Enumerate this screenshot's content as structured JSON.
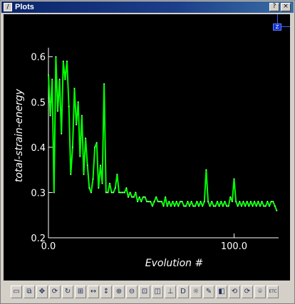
{
  "window": {
    "title": "Plots"
  },
  "titlebar_buttons": [
    {
      "name": "help-button",
      "glyph": "?"
    },
    {
      "name": "close-button",
      "glyph": "×"
    }
  ],
  "corner_icon": {
    "glyph": "Z"
  },
  "chart_data": {
    "type": "line",
    "xlabel": "Evolution  #",
    "ylabel": "total-strain-energy",
    "xlim": [
      0,
      124
    ],
    "ylim": [
      0.2,
      0.62
    ],
    "xticks": [
      0,
      100
    ],
    "xtick_labels": [
      "0.0",
      "100.0"
    ],
    "yticks": [
      0.2,
      0.3,
      0.4,
      0.5,
      0.6
    ],
    "ytick_labels": [
      "0.2",
      "0.3",
      "0.4",
      "0.5",
      "0.6"
    ],
    "grid": false,
    "line_color": "#00ff00",
    "series": [
      {
        "x": [
          0,
          1,
          2,
          3,
          4,
          5,
          6,
          7,
          8,
          9,
          10,
          11,
          12,
          13,
          14,
          15,
          16,
          17,
          18,
          19,
          20,
          21,
          22,
          23,
          24,
          25,
          26,
          27,
          28,
          29,
          30,
          31,
          32,
          33,
          34,
          35,
          36,
          37,
          38,
          39,
          40,
          41,
          42,
          43,
          44,
          45,
          46,
          47,
          48,
          49,
          50,
          51,
          52,
          53,
          54,
          55,
          56,
          57,
          58,
          59,
          60,
          61,
          62,
          63,
          64,
          65,
          66,
          67,
          68,
          69,
          70,
          71,
          72,
          73,
          74,
          75,
          76,
          77,
          78,
          79,
          80,
          81,
          82,
          83,
          84,
          85,
          86,
          87,
          88,
          89,
          90,
          91,
          92,
          93,
          94,
          95,
          96,
          97,
          98,
          99,
          100,
          101,
          102,
          103,
          104,
          105,
          106,
          107,
          108,
          109,
          110,
          111,
          112,
          113,
          114,
          115,
          116,
          117,
          118,
          119,
          120,
          121,
          122,
          123
        ],
        "y": [
          0.56,
          0.47,
          0.55,
          0.3,
          0.6,
          0.48,
          0.55,
          0.43,
          0.59,
          0.55,
          0.59,
          0.49,
          0.34,
          0.4,
          0.53,
          0.45,
          0.5,
          0.38,
          0.47,
          0.34,
          0.42,
          0.36,
          0.31,
          0.3,
          0.33,
          0.4,
          0.41,
          0.31,
          0.36,
          0.32,
          0.54,
          0.3,
          0.3,
          0.32,
          0.3,
          0.3,
          0.31,
          0.34,
          0.3,
          0.3,
          0.3,
          0.3,
          0.31,
          0.29,
          0.3,
          0.29,
          0.29,
          0.3,
          0.28,
          0.29,
          0.28,
          0.29,
          0.29,
          0.28,
          0.28,
          0.28,
          0.27,
          0.28,
          0.29,
          0.28,
          0.28,
          0.28,
          0.27,
          0.29,
          0.27,
          0.28,
          0.27,
          0.28,
          0.27,
          0.28,
          0.27,
          0.28,
          0.28,
          0.27,
          0.27,
          0.28,
          0.27,
          0.28,
          0.27,
          0.27,
          0.28,
          0.27,
          0.28,
          0.27,
          0.28,
          0.35,
          0.28,
          0.27,
          0.28,
          0.27,
          0.27,
          0.28,
          0.27,
          0.28,
          0.27,
          0.28,
          0.27,
          0.27,
          0.29,
          0.28,
          0.33,
          0.28,
          0.27,
          0.28,
          0.27,
          0.28,
          0.27,
          0.28,
          0.27,
          0.28,
          0.27,
          0.28,
          0.27,
          0.28,
          0.27,
          0.28,
          0.27,
          0.27,
          0.28,
          0.27,
          0.28,
          0.28,
          0.27,
          0.26
        ]
      }
    ]
  },
  "toolbar": {
    "tools": [
      {
        "name": "window-icon",
        "glyph": "▭"
      },
      {
        "name": "copy-icon",
        "glyph": "⧉"
      },
      {
        "name": "pan-icon",
        "glyph": "✥"
      },
      {
        "name": "refresh-icon",
        "glyph": "⟳"
      },
      {
        "name": "rotate-icon",
        "glyph": "↻"
      },
      {
        "name": "frame-icon",
        "glyph": "⊞"
      },
      {
        "name": "horizontal-arrows-icon",
        "glyph": "↔"
      },
      {
        "name": "vertical-arrows-icon",
        "glyph": "↕"
      },
      {
        "name": "zoom-in-icon",
        "glyph": "⊕"
      },
      {
        "name": "zoom-out-icon",
        "glyph": "⊖"
      },
      {
        "name": "zoom-box-icon",
        "glyph": "⊡"
      },
      {
        "name": "fit-icon",
        "glyph": "◫"
      },
      {
        "name": "axes-icon",
        "glyph": "⊥"
      },
      {
        "name": "default-icon",
        "glyph": "D"
      },
      {
        "name": "light-icon",
        "glyph": "☼"
      },
      {
        "name": "eraser-icon",
        "glyph": "✎"
      },
      {
        "name": "cube-icon",
        "glyph": "◧"
      },
      {
        "name": "rotate-view-icon",
        "glyph": "⟲"
      },
      {
        "name": "rotate-view-2-icon",
        "glyph": "⟳"
      },
      {
        "name": "camera-icon",
        "glyph": "⌾"
      },
      {
        "name": "etc-icon",
        "glyph": "ETC"
      }
    ]
  }
}
